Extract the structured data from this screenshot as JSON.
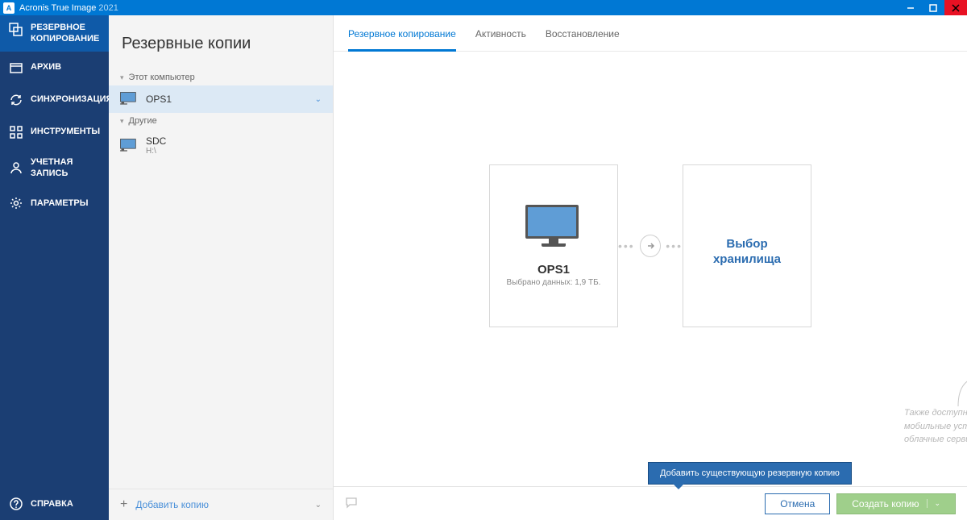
{
  "titlebar": {
    "app": "Acronis True Image",
    "year": "2021"
  },
  "nav": {
    "backup": "РЕЗЕРВНОЕ КОПИРОВАНИЕ",
    "archive": "АРХИВ",
    "sync": "СИНХРОНИЗАЦИЯ",
    "tools": "ИНСТРУМЕНТЫ",
    "account": "УЧЕТНАЯ ЗАПИСЬ",
    "settings": "ПАРАМЕТРЫ",
    "help": "СПРАВКА"
  },
  "list": {
    "header": "Резервные копии",
    "section_this_pc": "Этот компьютер",
    "item_ops1": "OPS1",
    "section_other": "Другие",
    "item_sdc": "SDC",
    "item_sdc_sub": "H:\\",
    "add": "Добавить копию"
  },
  "tabs": {
    "backup": "Резервное копирование",
    "activity": "Активность",
    "restore": "Восстановление"
  },
  "source_card": {
    "title": "OPS1",
    "sub": "Выбрано данных: 1,9 ТБ."
  },
  "target_card": {
    "line1": "Выбор",
    "line2": "хранилища"
  },
  "hint": "Также доступны диски, файлы, мобильные устройства и облачные сервисы",
  "tooltip": "Добавить существующую резервную копию",
  "buttons": {
    "cancel": "Отмена",
    "create": "Создать копию"
  }
}
